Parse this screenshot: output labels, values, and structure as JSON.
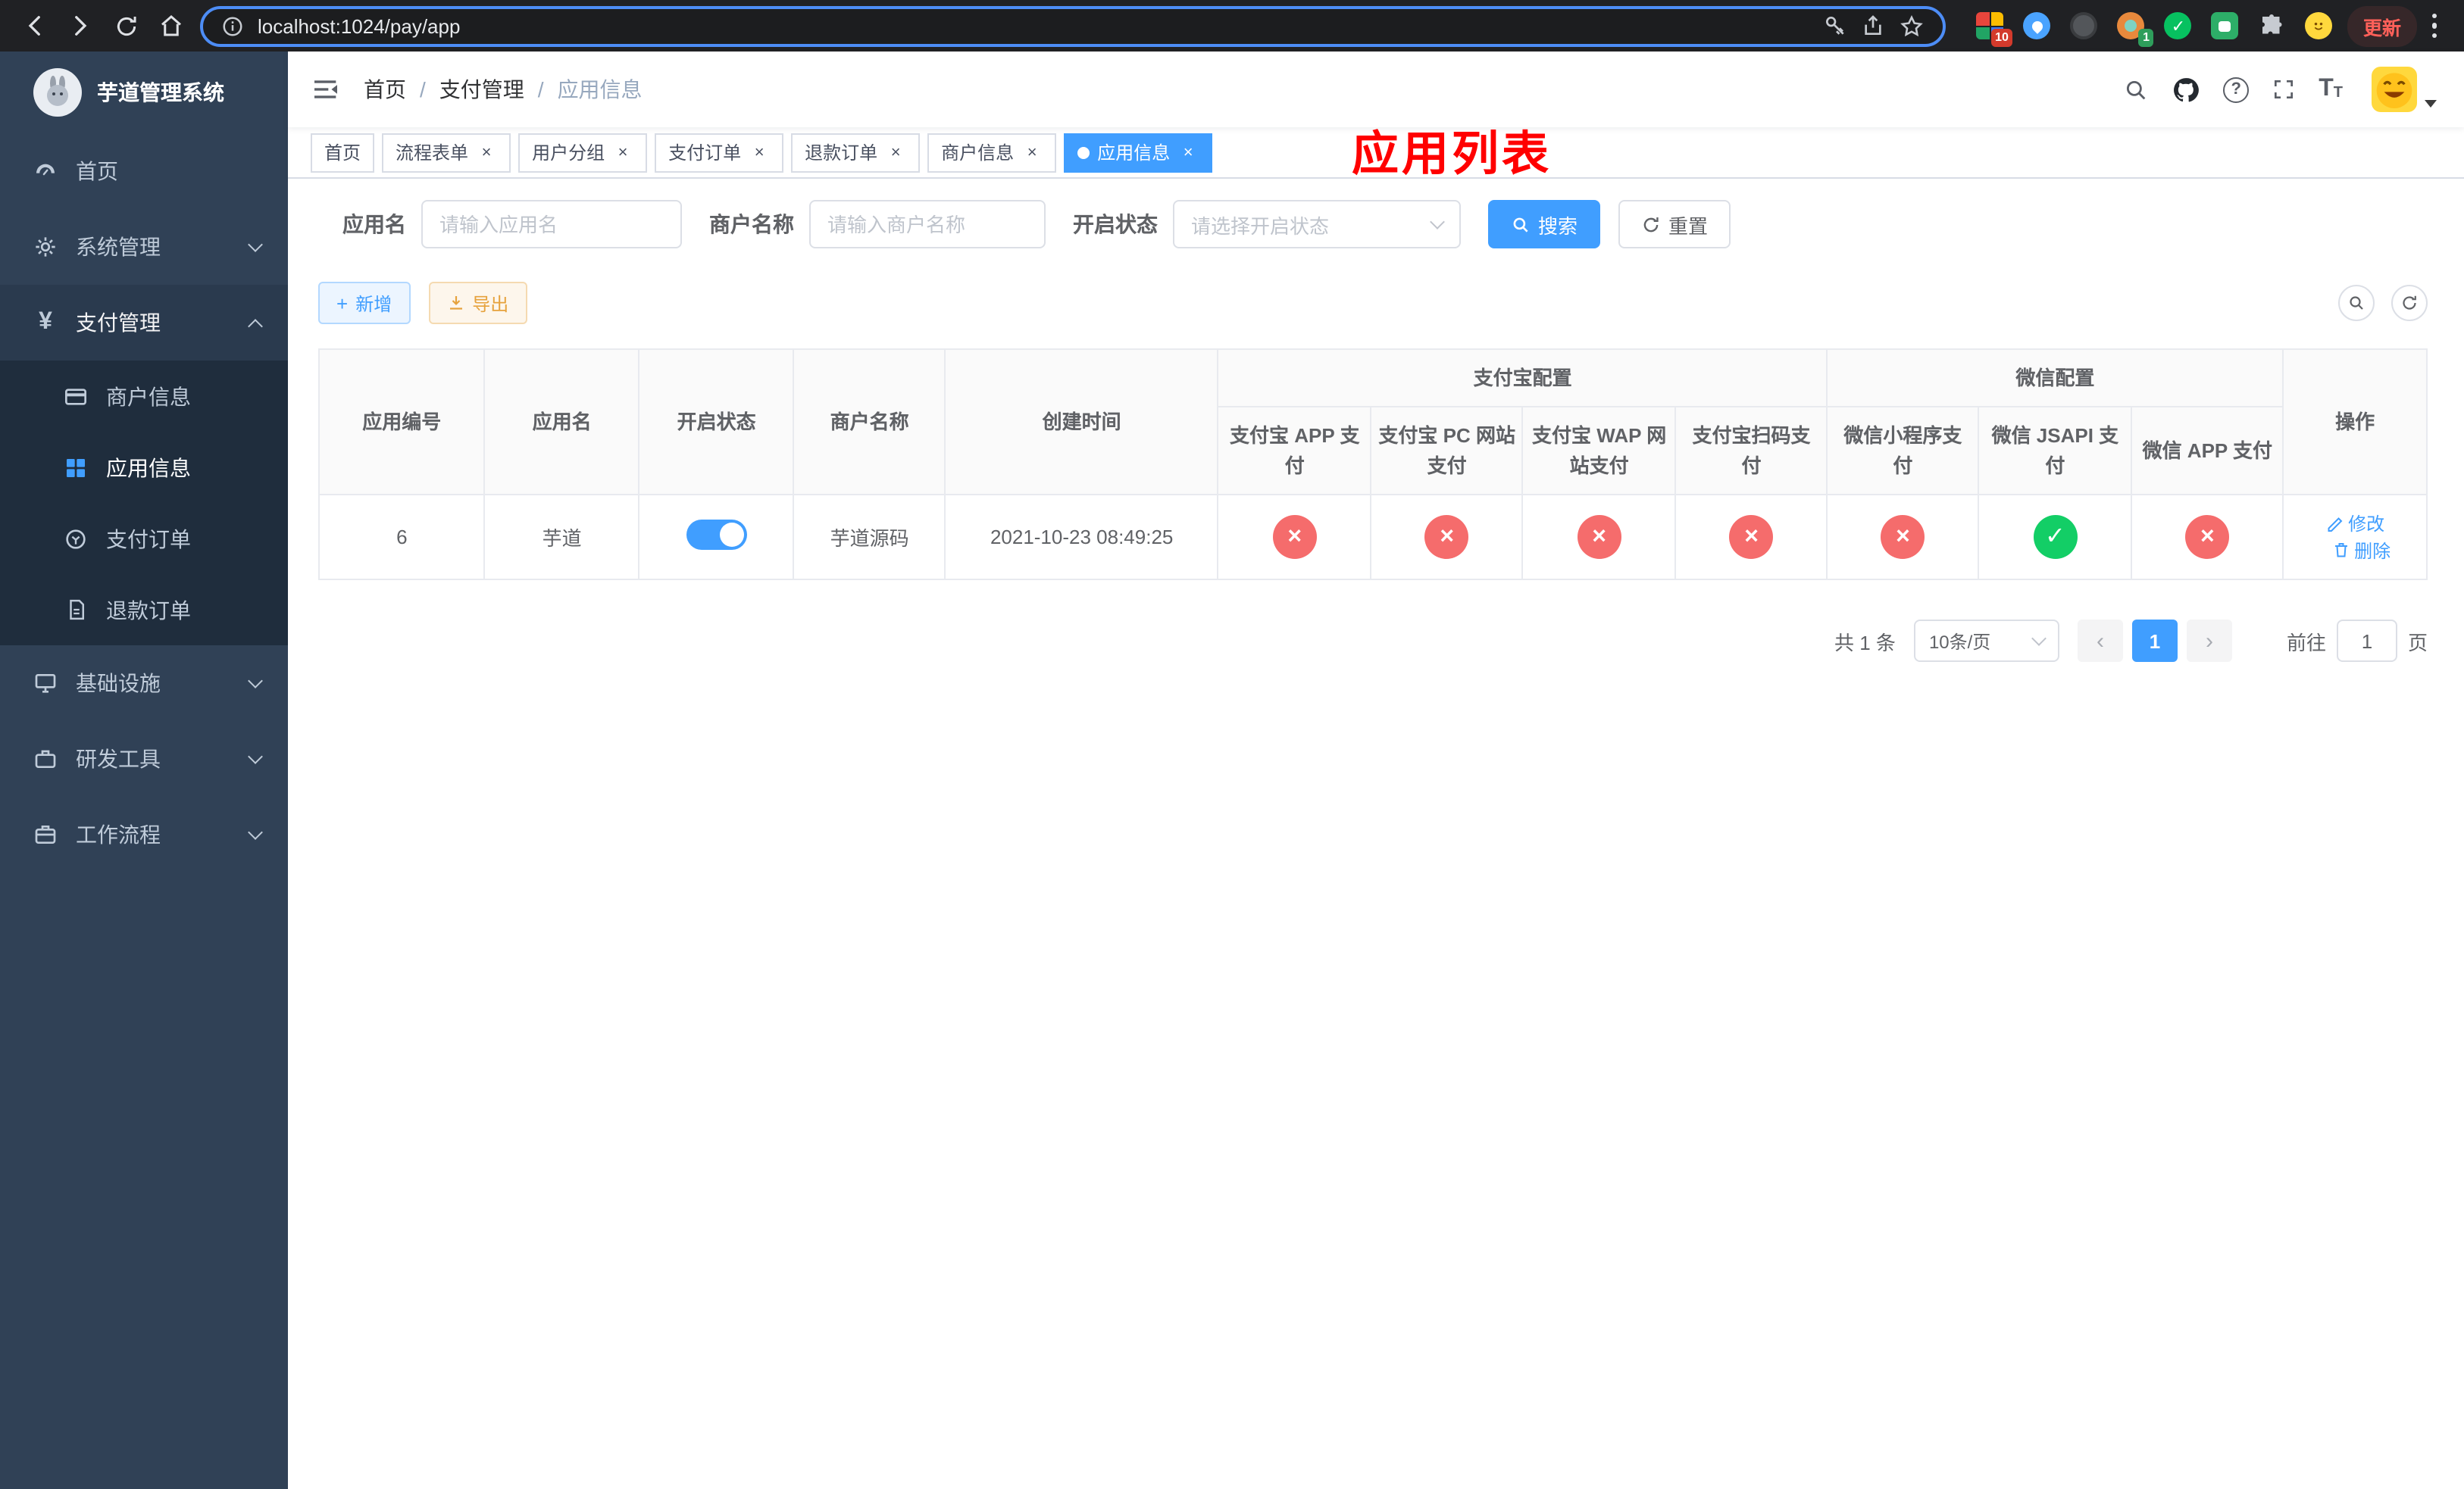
{
  "colors": {
    "accent": "#409eff",
    "success": "#13ce66",
    "danger": "#f56c6c",
    "warning": "#e6a23c",
    "sidebar_bg": "#304156",
    "overlay_title": "#ff0000"
  },
  "browser": {
    "url": "localhost:1024/pay/app",
    "update_label": "更新",
    "badge_extensions": "10",
    "badge_avatar": "1"
  },
  "sidebar": {
    "title": "芋道管理系统",
    "items": {
      "home": "首页",
      "system": "系统管理",
      "payment": "支付管理",
      "merchant_info": "商户信息",
      "app_info": "应用信息",
      "pay_order": "支付订单",
      "refund_order": "退款订单",
      "infra": "基础设施",
      "devtools": "研发工具",
      "workflow": "工作流程"
    }
  },
  "navbar": {
    "breadcrumb": {
      "home": "首页",
      "section": "支付管理",
      "current": "应用信息"
    },
    "overlay_title": "应用列表"
  },
  "tabs": [
    {
      "label": "首页"
    },
    {
      "label": "流程表单"
    },
    {
      "label": "用户分组"
    },
    {
      "label": "支付订单"
    },
    {
      "label": "退款订单"
    },
    {
      "label": "商户信息"
    },
    {
      "label": "应用信息"
    }
  ],
  "filters": {
    "app_name_label": "应用名",
    "app_name_placeholder": "请输入应用名",
    "merchant_label": "商户名称",
    "merchant_placeholder": "请输入商户名称",
    "status_label": "开启状态",
    "status_placeholder": "请选择开启状态",
    "search_label": "搜索",
    "reset_label": "重置"
  },
  "toolbar": {
    "add_label": "新增",
    "export_label": "导出"
  },
  "table": {
    "headers": {
      "app_id": "应用编号",
      "app_name": "应用名",
      "status": "开启状态",
      "merchant": "商户名称",
      "created": "创建时间",
      "alipay_group": "支付宝配置",
      "wechat_group": "微信配置",
      "alipay_app": "支付宝 APP 支付",
      "alipay_pc": "支付宝 PC 网站支付",
      "alipay_wap": "支付宝 WAP 网站支付",
      "alipay_qr": "支付宝扫码支付",
      "wx_mini": "微信小程序支付",
      "wx_jsapi": "微信 JSAPI 支付",
      "wx_app": "微信 APP 支付",
      "actions": "操作"
    },
    "row": {
      "id": "6",
      "name": "芋道",
      "enabled": true,
      "merchant": "芋道源码",
      "created": "2021-10-23 08:49:25",
      "statuses": {
        "alipay_app": false,
        "alipay_pc": false,
        "alipay_wap": false,
        "alipay_qr": false,
        "wx_mini": false,
        "wx_jsapi": true,
        "wx_app": false
      },
      "edit_label": "修改",
      "delete_label": "删除"
    }
  },
  "pagination": {
    "total": "共 1 条",
    "page_size": "10条/页",
    "page": "1",
    "goto_label": "前往",
    "goto_value": "1",
    "unit_label": "页"
  }
}
